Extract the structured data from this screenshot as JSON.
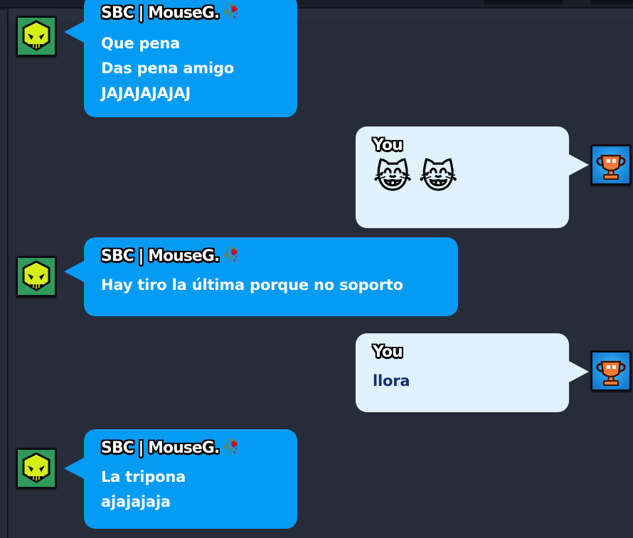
{
  "contact": {
    "name": "SBC | MouseG.",
    "name_emoji": "🥀",
    "avatar_icon": "skull-icon"
  },
  "me": {
    "name": "You",
    "avatar_icon": "trophy-icon"
  },
  "colors": {
    "background": "#272c3b",
    "incoming_bubble": "#049bf5",
    "outgoing_bubble": "#dff2fd",
    "outgoing_text": "#15306f",
    "skull_avatar": "#2f9a5a",
    "trophy_avatar": "#1f8fe0"
  },
  "messages": [
    {
      "from": "contact",
      "sender": "SBC | MouseG.",
      "lines": [
        "Que pena",
        "Das pena amigo",
        "JAJAJAJAJAJ"
      ]
    },
    {
      "from": "me",
      "sender": "You",
      "emoji": "😹😹"
    },
    {
      "from": "contact",
      "sender": "SBC | MouseG.",
      "lines": [
        "Hay tiro la última porque no soporto"
      ]
    },
    {
      "from": "me",
      "sender": "You",
      "lines": [
        "llora"
      ]
    },
    {
      "from": "contact",
      "sender": "SBC | MouseG.",
      "lines": [
        "La tripona",
        "ajajajaja"
      ]
    }
  ]
}
